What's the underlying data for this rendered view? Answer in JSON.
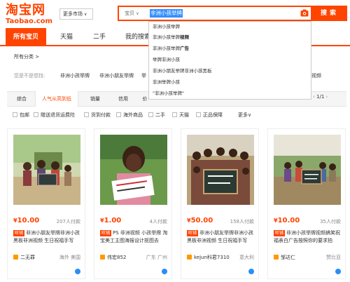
{
  "logo": {
    "line1": "淘宝网",
    "line2": "Taobao.com"
  },
  "market": {
    "label": "更多市场",
    "caret": "∨"
  },
  "search": {
    "scope": "宝贝",
    "scope_caret": "∨",
    "query": "非洲小孩举牌",
    "button": "搜索"
  },
  "tabs": [
    "所有宝贝",
    "天猫",
    "二手",
    "我的搜索"
  ],
  "suggestions": [
    {
      "text": "非洲小孩举牌",
      "bold": ""
    },
    {
      "text": "非洲小孩举牌",
      "bold": "视频"
    },
    {
      "text": "非洲小孩举牌",
      "bold": "广告"
    },
    {
      "text": "举牌非洲小孩",
      "bold": ""
    },
    {
      "text": "非洲小朋友举牌非洲小孩黑板",
      "bold": ""
    },
    {
      "text": "非洲举牌小孩",
      "bold": ""
    },
    {
      "text": "\"非洲小孩举牌\"",
      "bold": ""
    }
  ],
  "breadcrumb": {
    "all": "所有分类 >"
  },
  "thinking": {
    "label": "您是不是想找:",
    "items": [
      "非洲小孩举牌",
      "非洲小朋友举牌",
      "举",
      "视频"
    ]
  },
  "sort": {
    "items": [
      "综合",
      "人气从高到低",
      "销量",
      "信用",
      "价"
    ],
    "active_index": 1,
    "pager": "1/1"
  },
  "options": [
    "包邮",
    "赠送退货运费险",
    "货到付款",
    "海外商品",
    "二手",
    "天猫",
    "正品保障"
  ],
  "more": "更多∨",
  "cards": [
    {
      "price": "10.00",
      "sales": "207人付款",
      "title_pre": "非洲小朋友举牌非洲小孩黑板非洲视频 生日祝福手写",
      "shop": "二无罪",
      "loc": "海外 美国"
    },
    {
      "price": "1.00",
      "sales": "4人付款",
      "title_pre": "PS 非洲视频 小孩举牌 淘宝美工主图海报设计抠图去",
      "shop": "伟宏852",
      "loc": "广东 广州"
    },
    {
      "price": "50.00",
      "sales": "158人付款",
      "title_pre": "非洲小朋友举牌非洲小孩黑板非洲视频 生日祝福手写",
      "shop": "kejun科君7310",
      "loc": "意大利"
    },
    {
      "price": "10.00",
      "sales": "35人付款",
      "title_pre": "非洲小孩举牌视频搞笑祝福表白广告按照你的要求拍",
      "shop": "邹达仁",
      "loc": "赞比亚"
    }
  ],
  "colors": {
    "accent": "#ff4400",
    "link": "#3388ff"
  }
}
